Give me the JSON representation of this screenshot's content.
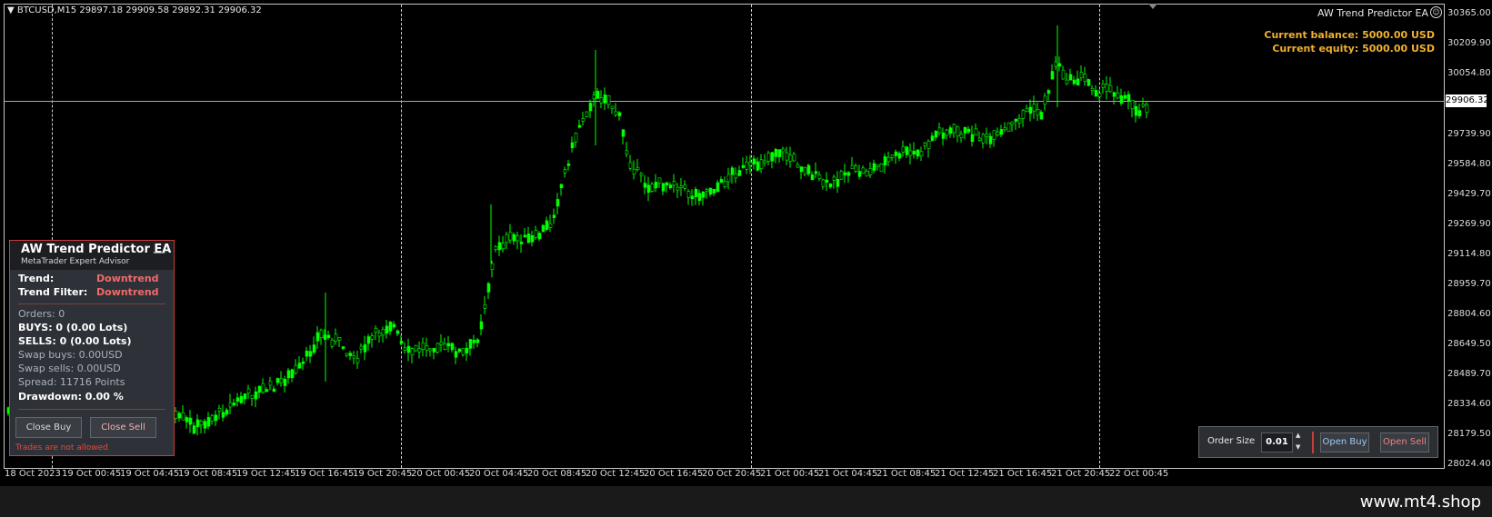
{
  "chart": {
    "symbol_info": "BTCUSD,M15  29897.18 29909.58 29892.31 29906.32",
    "ea_name": "AW Trend Predictor EA",
    "current_price": "29906.32",
    "price_scale": [
      "30365.00",
      "30209.90",
      "30054.80",
      "29739.90",
      "29584.80",
      "29429.70",
      "29269.90",
      "29114.80",
      "28959.70",
      "28804.60",
      "28649.50",
      "28489.70",
      "28334.60",
      "28179.50",
      "28024.40"
    ],
    "time_scale": [
      "18 Oct 2023",
      "19 Oct 00:45",
      "19 Oct 04:45",
      "19 Oct 08:45",
      "19 Oct 12:45",
      "19 Oct 16:45",
      "19 Oct 20:45",
      "20 Oct 00:45",
      "20 Oct 04:45",
      "20 Oct 08:45",
      "20 Oct 12:45",
      "20 Oct 16:45",
      "20 Oct 20:45",
      "21 Oct 00:45",
      "21 Oct 04:45",
      "21 Oct 08:45",
      "21 Oct 12:45",
      "21 Oct 16:45",
      "21 Oct 20:45",
      "22 Oct 00:45"
    ],
    "candle_color": "#00ff00"
  },
  "account": {
    "balance": "Current balance: 5000.00 USD",
    "equity": "Current equity: 5000.00 USD"
  },
  "ea_panel": {
    "title": "AW Trend Predictor EA",
    "subtitle": "MetaTrader Expert Advisor",
    "minimize_label": "—",
    "trend_label": "Trend:",
    "trend_value": "Downtrend",
    "trend_filter_label": "Trend Filter:",
    "trend_filter_value": "Downtrend",
    "orders": "Orders: 0",
    "buys": "BUYS: 0 (0.00 Lots)",
    "sells": "SELLS: 0 (0.00 Lots)",
    "swap_buys": "Swap buys: 0.00USD",
    "swap_sells": "Swap sells: 0.00USD",
    "spread": "Spread: 11716 Points",
    "drawdown": "Drawdown: 0.00 %",
    "close_buy": "Close Buy",
    "close_sell": "Close Sell",
    "warning": "Trades are not allowed"
  },
  "order_box": {
    "label": "Order Size",
    "value": "0.01",
    "open_buy": "Open Buy",
    "open_sell": "Open Sell"
  },
  "footer": {
    "watermark": "www.mt4.shop"
  }
}
